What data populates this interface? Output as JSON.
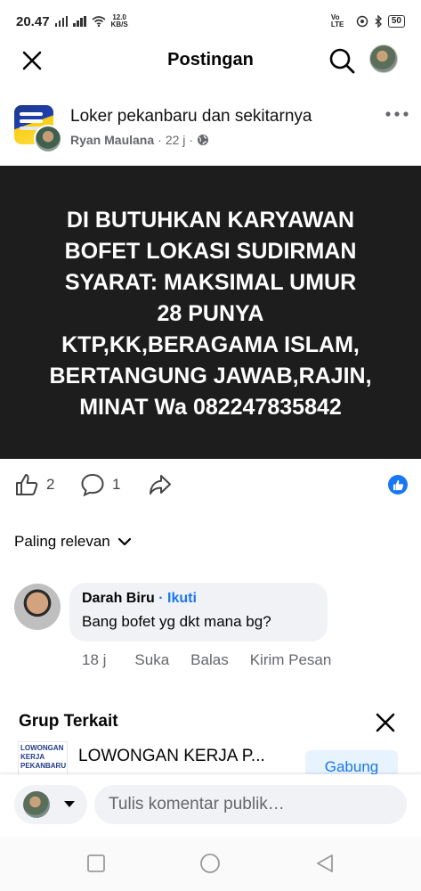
{
  "status": {
    "time": "20.47",
    "speed_value": "12.0",
    "speed_unit": "KB/S",
    "network_label": "Vo LTE",
    "battery": "50"
  },
  "header": {
    "title": "Postingan"
  },
  "post": {
    "group_name": "Loker pekanbaru dan sekitarnya",
    "author": "Ryan Maulana",
    "time": "22 j",
    "content": "DI BUTUHKAN KARYAWAN\nBOFET LOKASI  SUDIRMAN\nSYARAT: MAKSIMAL UMUR\n28 PUNYA\nKTP,KK,BERAGAMA ISLAM,\nBERTANGUNG JAWAB,RAJIN,\nMINAT Wa 082247835842",
    "like_count": "2",
    "comment_count": "1",
    "background_color": "#1d1d1d"
  },
  "comments": {
    "sort_label": "Paling relevan",
    "items": [
      {
        "name": "Darah Biru",
        "follow_label": "Ikuti",
        "text": "Bang bofet yg dkt mana bg?",
        "time": "18 j",
        "like_label": "Suka",
        "reply_label": "Balas",
        "message_label": "Kirim Pesan"
      }
    ]
  },
  "related": {
    "title": "Grup Terkait",
    "group_name": "LOWONGAN KERJA P...",
    "thumb_text": "LOWONGAN KERJA PEKANBARU",
    "join_label": "Gabung"
  },
  "composer": {
    "placeholder": "Tulis komentar publik…"
  },
  "colors": {
    "accent": "#1877f2",
    "secondary_text": "#65676b",
    "bubble": "#f0f2f5"
  },
  "icons": {
    "close": "close-icon",
    "search": "search-icon",
    "more": "more-dots-icon",
    "globe": "globe-icon",
    "like": "thumbs-up-icon",
    "comment": "comment-bubble-icon",
    "share": "share-arrow-icon",
    "chevron": "chevron-down-icon",
    "nav_recent": "square-icon",
    "nav_home": "circle-icon",
    "nav_back": "triangle-back-icon"
  }
}
